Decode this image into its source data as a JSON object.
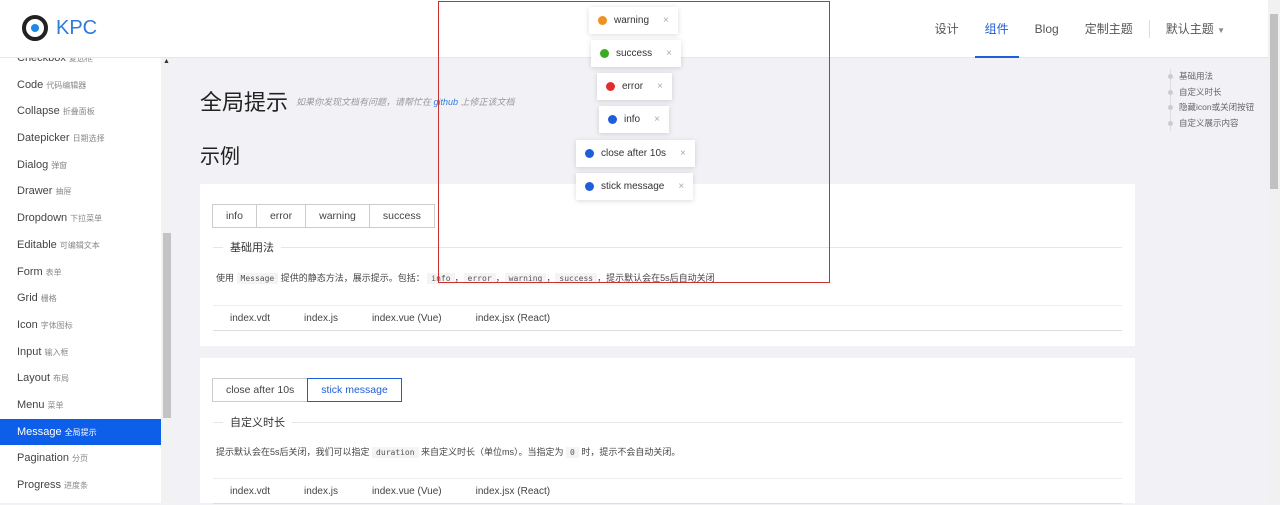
{
  "header": {
    "logo": "KPC",
    "nav": [
      "设计",
      "组件",
      "Blog",
      "定制主题"
    ],
    "theme": "默认主题"
  },
  "sidebar": {
    "items": [
      {
        "name": "Checkbox",
        "cn": "复选框"
      },
      {
        "name": "Code",
        "cn": "代码编辑器"
      },
      {
        "name": "Collapse",
        "cn": "折叠面板"
      },
      {
        "name": "Datepicker",
        "cn": "日期选择"
      },
      {
        "name": "Dialog",
        "cn": "弹窗"
      },
      {
        "name": "Drawer",
        "cn": "抽屉"
      },
      {
        "name": "Dropdown",
        "cn": "下拉菜单"
      },
      {
        "name": "Editable",
        "cn": "可编辑文本"
      },
      {
        "name": "Form",
        "cn": "表单"
      },
      {
        "name": "Grid",
        "cn": "栅格"
      },
      {
        "name": "Icon",
        "cn": "字体图标"
      },
      {
        "name": "Input",
        "cn": "输入框"
      },
      {
        "name": "Layout",
        "cn": "布局"
      },
      {
        "name": "Menu",
        "cn": "菜单"
      },
      {
        "name": "Message",
        "cn": "全局提示"
      },
      {
        "name": "Pagination",
        "cn": "分页"
      },
      {
        "name": "Progress",
        "cn": "进度条"
      }
    ],
    "active": "Message"
  },
  "page": {
    "title": "全局提示",
    "subtitle_pre": "如果你发现文档有问题，请帮忙在 ",
    "subtitle_link": "github",
    "subtitle_post": " 上修正该文档",
    "section": "示例"
  },
  "toc": [
    "基础用法",
    "自定义时长",
    "隐藏icon或关闭按钮",
    "自定义展示内容"
  ],
  "demo1": {
    "buttons": [
      "info",
      "error",
      "warning",
      "success"
    ],
    "legend": "基础用法",
    "desc": {
      "t1": "使用 ",
      "c1": "Message",
      "t2": " 提供的静态方法，展示提示。包括：",
      "c2": "info",
      "c3": "error",
      "c4": "warning",
      "c5": "success",
      "sep": "，",
      "t3": "，提示默认会在5s后自动关闭"
    },
    "code_tabs": [
      "index.vdt",
      "index.js",
      "index.vue (Vue)",
      "index.jsx (React)"
    ]
  },
  "demo2": {
    "buttons": [
      "close after 10s",
      "stick message"
    ],
    "legend": "自定义时长",
    "desc": {
      "t1": "提示默认会在5s后关闭，我们可以指定 ",
      "c1": "duration",
      "t2": " 来自定义时长（单位ms）。当指定为 ",
      "c2": "0",
      "t3": " 时，提示不会自动关闭。"
    },
    "code_tabs": [
      "index.vdt",
      "index.js",
      "index.vue (Vue)",
      "index.jsx (React)"
    ]
  },
  "messages": [
    {
      "text": "warning",
      "type": "warning",
      "color": "#f0901e"
    },
    {
      "text": "success",
      "type": "success",
      "color": "#3dab22"
    },
    {
      "text": "error",
      "type": "error",
      "color": "#e02d2d"
    },
    {
      "text": "info",
      "type": "info",
      "color": "#1e5ed8"
    },
    {
      "text": "close after 10s",
      "type": "info",
      "color": "#1e5ed8"
    },
    {
      "text": "stick message",
      "type": "info",
      "color": "#1e5ed8"
    }
  ],
  "close_glyph": "×"
}
